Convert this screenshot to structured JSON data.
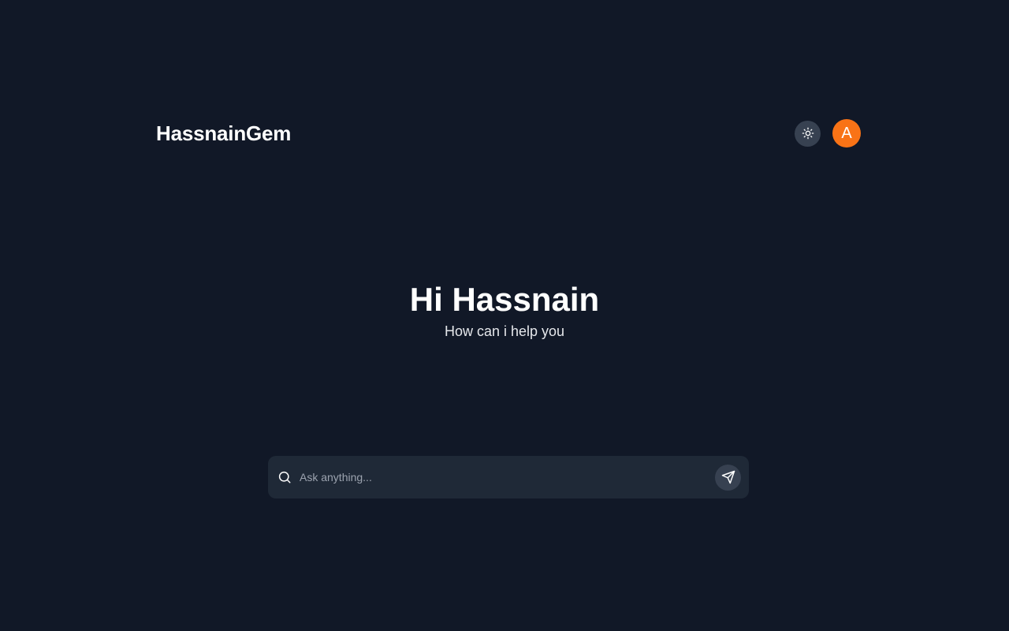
{
  "header": {
    "brand": "HassnainGem",
    "theme_icon": "sun-icon",
    "avatar_initial": "A",
    "avatar_color": "#f97316"
  },
  "hero": {
    "title": "Hi Hassnain",
    "subtitle": "How can i help you"
  },
  "search": {
    "icon": "search-icon",
    "placeholder": "Ask anything...",
    "value": "",
    "send_icon": "send-icon"
  },
  "colors": {
    "background": "#111827",
    "surface": "#1f2937",
    "button": "#374151",
    "accent": "#f97316"
  }
}
